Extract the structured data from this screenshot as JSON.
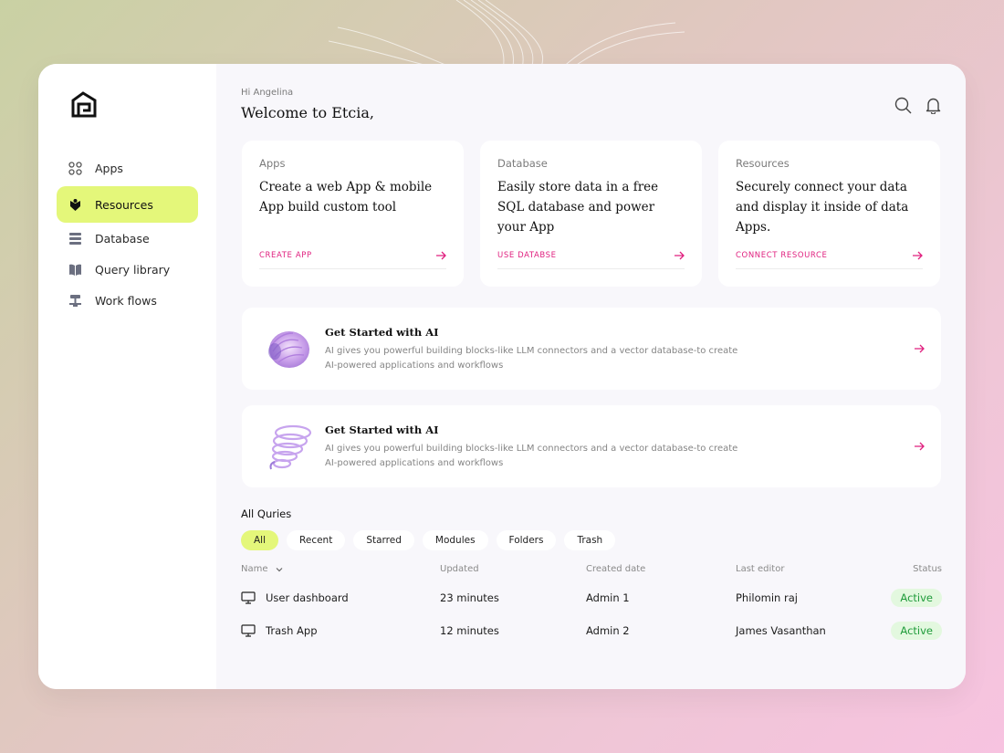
{
  "app": {
    "accent": "#e4f77a",
    "link_color": "#e0207f",
    "status_color": "#1f9b3a"
  },
  "sidebar": {
    "logo": "house-logo-icon",
    "items": [
      {
        "label": "Apps",
        "icon": "grid-icon"
      },
      {
        "label": "Resources",
        "icon": "resources-icon",
        "active": true
      },
      {
        "label": "Database",
        "icon": "database-icon"
      },
      {
        "label": "Query library",
        "icon": "book-icon"
      },
      {
        "label": "Work flows",
        "icon": "workflow-icon"
      }
    ]
  },
  "header": {
    "greeting": "Hi Angelina",
    "welcome": "Welcome to Etcia,",
    "icons": [
      "search-icon",
      "bell-icon"
    ]
  },
  "cards": [
    {
      "category": "Apps",
      "title": "Create a web App & mobile App build custom tool",
      "link": "CREATE APP"
    },
    {
      "category": "Database",
      "title": "Easily store data in a free SQL database and power your App",
      "link": "USE DATABSE"
    },
    {
      "category": "Resources",
      "title": "Securely connect your data and display it inside of data Apps.",
      "link": "CONNECT RESOURCE"
    }
  ],
  "banners": [
    {
      "title": "Get Started with AI",
      "description": "AI gives you powerful building blocks-like LLM connectors and a vector database-to create AI-powered applications and workflows"
    },
    {
      "title": "Get Started with AI",
      "description": "AI gives you powerful building blocks-like LLM connectors and a vector database-to create AI-powered applications and workflows"
    }
  ],
  "queries": {
    "title": "All Quries",
    "filters": [
      "All",
      "Recent",
      "Starred",
      "Modules",
      "Folders",
      "Trash"
    ],
    "active_filter": "All",
    "columns": [
      "Name",
      "Updated",
      "Created date",
      "Last editor",
      "Status"
    ],
    "rows": [
      {
        "name": "User dashboard",
        "updated": "23 minutes",
        "created": "Admin 1",
        "editor": "Philomin raj",
        "status": "Active"
      },
      {
        "name": "Trash App",
        "updated": "12 minutes",
        "created": "Admin 2",
        "editor": "James Vasanthan",
        "status": "Active"
      }
    ]
  }
}
